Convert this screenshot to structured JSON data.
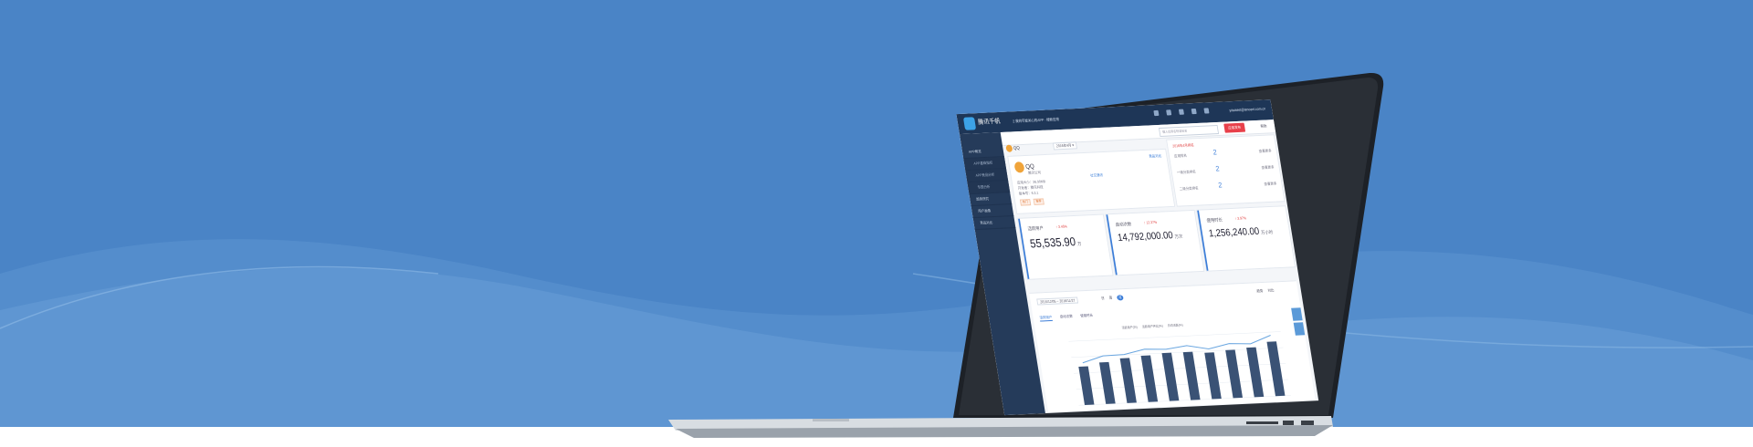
{
  "app": {
    "brand": "腾讯千帆",
    "breadcrumb": "2 我的可能关心的APP · 搜索应用",
    "user_email": "yitaotest@tencent.com.cn"
  },
  "toolbar": {
    "search_placeholder": "输入应用名称或包名",
    "publish_label": "应用发布",
    "help_label": "帮助"
  },
  "sidebar": {
    "items": [
      {
        "label": "APP概览"
      },
      {
        "label": "APP基础指标"
      },
      {
        "label": "APP竞品分析"
      },
      {
        "label": "专题分析"
      },
      {
        "label": "趋势研究"
      },
      {
        "label": "用户画像"
      },
      {
        "label": "竞品对比"
      }
    ]
  },
  "app_card": {
    "app_name": "QQ",
    "tab_label": "QQ",
    "filter_label": "2016年4月 ▾",
    "developer_label": "腾讯公司",
    "category": "社交通讯",
    "tags": [
      "热门",
      "推荐"
    ],
    "info_rows": [
      "应用大小：36.90MB",
      "开发者：腾讯科技",
      "版本号：6.3.1"
    ],
    "related_label": "竞品对比"
  },
  "rank_card": {
    "title": "2016年4月排名",
    "rows": [
      {
        "label": "应用排名",
        "value": "2",
        "tail": "查看更多"
      },
      {
        "label": "一级分类排名",
        "value": "2",
        "tail": "查看更多"
      },
      {
        "label": "二级分类排名",
        "value": "2",
        "tail": "查看更多"
      }
    ]
  },
  "metrics": [
    {
      "label": "活跃用户",
      "sub": "↑ 3.45%",
      "value": "55,535.90",
      "unit": "万"
    },
    {
      "label": "启动次数",
      "sub": "↑ 12.37%",
      "value": "14,792,000.00",
      "unit": "万次"
    },
    {
      "label": "使用时长",
      "sub": "↑ 3.97%",
      "value": "1,256,240.00",
      "unit": "万小时"
    }
  ],
  "chart": {
    "date_range": "2015/12/05 ~ 2016/11/27",
    "granularity": [
      "日",
      "周",
      "月"
    ],
    "active_granularity": "月",
    "export_labels": [
      "趋势",
      "对比"
    ],
    "tabs": [
      "活跃用户",
      "启动次数",
      "使用时长"
    ],
    "active_tab": "活跃用户",
    "legend": [
      "活跃用户(万)",
      "活跃用户环比(%)",
      "日均活跃(%)"
    ],
    "chart_data": {
      "type": "bar",
      "title": "",
      "categories": [
        "1",
        "2",
        "3",
        "4",
        "5",
        "6",
        "7",
        "8",
        "9",
        "10"
      ],
      "series": [
        {
          "name": "活跃用户(万)",
          "values": [
            48,
            52,
            56,
            58,
            60,
            60,
            58,
            60,
            62,
            68
          ]
        }
      ],
      "ylim": [
        0,
        80
      ],
      "grid": true
    }
  },
  "colors": {
    "background": "#4a84c6",
    "wave": "#5b92cf",
    "screen_topbar": "#1e3657",
    "sidebar": "#253b5a",
    "accent": "#3b7dd8",
    "publish": "#e8404a"
  }
}
